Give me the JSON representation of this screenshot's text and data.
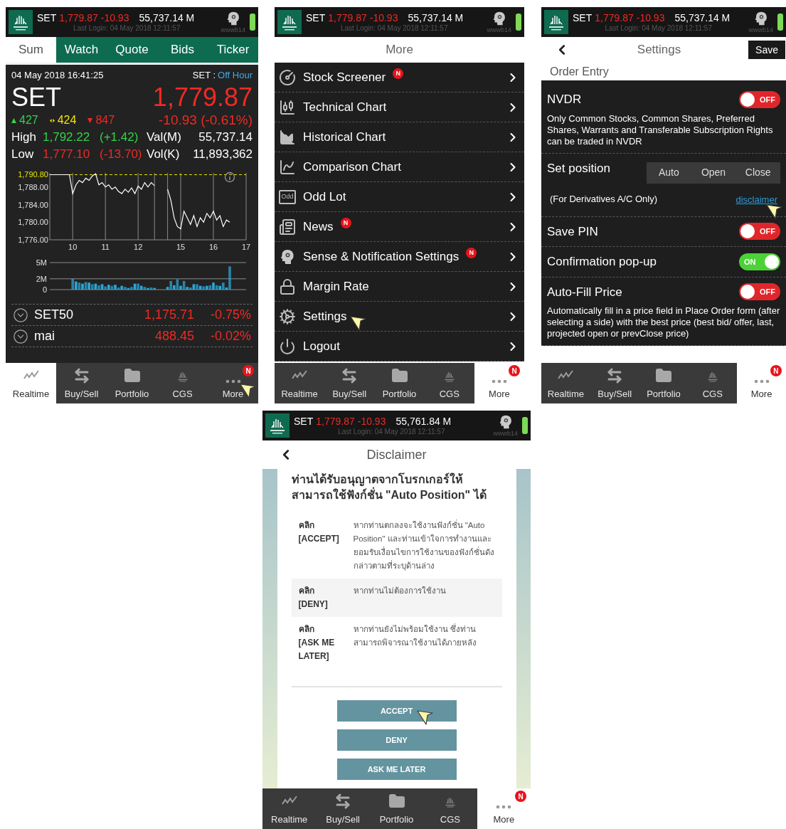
{
  "screens": [
    {
      "kind": "summary",
      "status": {
        "index": "SET",
        "price": "1,779.87",
        "change": "-10.93",
        "value": "55,737.14 M",
        "last_login": "Last Login: 04 May 2018 12:11:57",
        "user": "wwwb14"
      },
      "tabs": [
        {
          "label": "Sum",
          "selected": true
        },
        {
          "label": "Watch",
          "selected": false
        },
        {
          "label": "Quote",
          "selected": false
        },
        {
          "label": "Bids",
          "selected": false
        },
        {
          "label": "Ticker",
          "selected": false
        }
      ],
      "timestamp": "04 May 2018 16:41:25",
      "market_label": "SET :",
      "market_status": "Off Hour",
      "index_name": "SET",
      "index_price": "1,779.87",
      "breadth": [
        {
          "kind": "up",
          "count": "427"
        },
        {
          "kind": "flat",
          "count": "424"
        },
        {
          "kind": "down",
          "count": "847"
        }
      ],
      "index_change": "-10.93 (-0.61%)",
      "stats": [
        {
          "label": "High",
          "value": "1,792.22",
          "change": "(+1.42)",
          "color": "#35d24a",
          "metric": "Val(M)",
          "metric_value": "55,737.14"
        },
        {
          "label": "Low",
          "value": "1,777.10",
          "change": "(-13.70)",
          "color": "#ee2a24",
          "metric": "Vol(K)",
          "metric_value": "11,893,362"
        }
      ],
      "price_chart": {
        "chart_data": {
          "type": "line",
          "grid": true,
          "ylim": [
            1776,
            1791.2
          ],
          "categories": [
            null,
            null,
            null,
            null,
            null,
            null,
            null,
            "10",
            null,
            null,
            null,
            null,
            null,
            null,
            null,
            null,
            null,
            "11",
            null,
            null,
            null,
            null,
            null,
            null,
            null,
            null,
            null,
            "12",
            null,
            null,
            null,
            null,
            null,
            null,
            null,
            null,
            null,
            null,
            null,
            null,
            "15",
            null,
            null,
            null,
            null,
            null,
            null,
            null,
            null,
            null,
            "16",
            null,
            null,
            null,
            null,
            null,
            null,
            null,
            null,
            null,
            "17"
          ],
          "yticks": [
            {
              "value": 1776,
              "label": "1,776.00"
            },
            {
              "value": 1780,
              "label": "1,780.00"
            },
            {
              "value": 1784,
              "label": "1,784.00"
            },
            {
              "value": 1788,
              "label": "1,788.00"
            }
          ],
          "series": [
            {
              "color": "#ffffff",
              "values": [
                1790.8,
                1790.8,
                1790.8,
                1790.8,
                1790.8,
                1790.8,
                1790.8,
                1786.5,
                1788.5,
                1789.5,
                1789,
                1790,
                1789.5,
                1790.5,
                1791,
                1788.5,
                1789,
                1788,
                1788.5,
                1787.5,
                1788,
                1787,
                1786.5,
                1787.5,
                1786.8,
                1787.8,
                1786.5,
                1788.2,
                1787.5,
                1789,
                1788,
                1789,
                1788.3,
                null,
                null,
                null,
                1787.5,
                1785,
                1781,
                1779,
                1778.5,
                1782.5,
                1781,
                1779.5,
                1781.5,
                1779,
                1781,
                1780,
                1782,
                1781,
                1782.5,
                1780.5,
                1781.5,
                1779,
                1780.5,
                1780,
                null,
                null,
                null,
                null,
                null
              ]
            }
          ],
          "annotations": [
            "1,790.80"
          ]
        }
      },
      "volume_chart": {
        "chart_data": {
          "type": "bar",
          "grid": true,
          "ylim": [
            0,
            5
          ],
          "categories": [
            null,
            null,
            null,
            null,
            null,
            null,
            null,
            null,
            null,
            null,
            null,
            null,
            null,
            null,
            null,
            null,
            null,
            null,
            null,
            null,
            null,
            null,
            null,
            null,
            null,
            null,
            null,
            null,
            null,
            null,
            null,
            null,
            null,
            null,
            null,
            null,
            null,
            null,
            null,
            null,
            null,
            null,
            null,
            null,
            null,
            null,
            null,
            null,
            null,
            null,
            null,
            null,
            null,
            null,
            null,
            null,
            null,
            null,
            null,
            null,
            null
          ],
          "yticks": [
            {
              "value": 0,
              "label": "0"
            },
            {
              "value": 2,
              "label": "2M"
            },
            {
              "value": 5,
              "label": "5M"
            }
          ],
          "series": [
            {
              "color": "#2aa7d8",
              "values": [
                null,
                null,
                null,
                null,
                null,
                null,
                null,
                2.0,
                1.5,
                1.3,
                1.1,
                1.4,
                1.3,
                1.0,
                1.1,
                0.8,
                1.0,
                0.6,
                0.9,
                0.7,
                0.9,
                0.4,
                0.7,
                0.5,
                0.3,
                0.5,
                1.1,
                1.1,
                0.7,
                0.5,
                0.3,
                0.4,
                0.3,
                null,
                null,
                null,
                0.5,
                1.6,
                0.8,
                1.9,
                0.7,
                1.6,
                0.5,
                0.4,
                1.0,
                1.0,
                0.7,
                0.6,
                0.7,
                0.8,
                1.3,
                0.8,
                0.7,
                1.3,
                0.4,
                4.3,
                null,
                null,
                null,
                null,
                null
              ]
            }
          ]
        }
      },
      "indices": [
        {
          "name": "SET50",
          "price": "1,175.71",
          "change": "-0.75%"
        },
        {
          "name": "mai",
          "price": "488.45",
          "change": "-0.02%"
        }
      ],
      "nav": [
        {
          "kind": "realtime",
          "label": "Realtime",
          "selected": true
        },
        {
          "kind": "trade",
          "label": "Buy/Sell",
          "selected": false
        },
        {
          "kind": "portfolio",
          "label": "Portfolio",
          "selected": false
        },
        {
          "kind": "cgs",
          "label": "CGS",
          "selected": false
        },
        {
          "kind": "more",
          "label": "More",
          "selected": false,
          "badge": "N",
          "pointer": true
        }
      ]
    },
    {
      "kind": "menu",
      "status": {
        "index": "SET",
        "price": "1,779.87",
        "change": "-10.93",
        "value": "55,737.14 M",
        "last_login": "Last Login: 04 May 2018 12:11:57",
        "user": "wwwb14"
      },
      "title": "More",
      "items": [
        {
          "kind": "screener",
          "label": "Stock Screener",
          "badge": "N"
        },
        {
          "kind": "technical",
          "label": "Technical Chart"
        },
        {
          "kind": "historical",
          "label": "Historical Chart"
        },
        {
          "kind": "comparison",
          "label": "Comparison Chart"
        },
        {
          "kind": "oddlot",
          "label": "Odd Lot",
          "icon_text": "Odd"
        },
        {
          "kind": "news",
          "label": "News",
          "badge": "N"
        },
        {
          "kind": "sense",
          "label": "Sense & Notification Settings",
          "badge": "N"
        },
        {
          "kind": "margin",
          "label": "Margin Rate"
        },
        {
          "kind": "settings",
          "label": "Settings",
          "pointer": true
        },
        {
          "kind": "logout",
          "label": "Logout"
        }
      ],
      "nav": [
        {
          "kind": "realtime",
          "label": "Realtime",
          "selected": false
        },
        {
          "kind": "trade",
          "label": "Buy/Sell",
          "selected": false
        },
        {
          "kind": "portfolio",
          "label": "Portfolio",
          "selected": false
        },
        {
          "kind": "cgs",
          "label": "CGS",
          "selected": false
        },
        {
          "kind": "more",
          "label": "More",
          "selected": true,
          "badge": "N"
        }
      ]
    },
    {
      "kind": "settings",
      "status": {
        "index": "SET",
        "price": "1,779.87",
        "change": "-10.93",
        "value": "55,737.14 M",
        "last_login": "Last Login: 04 May 2018 12:11:57",
        "user": "wwwb14"
      },
      "title": "Settings",
      "save": "Save",
      "section": "Order Entry",
      "rows": [
        {
          "kind": "toggle",
          "label": "NVDR",
          "on": false,
          "state_label": "OFF",
          "description": "Only Common Stocks, Common Shares, Preferred Shares, Warrants and Transferable Subscription Rights can be traded in NVDR"
        },
        {
          "kind": "segments",
          "label": "Set position",
          "options": [
            {
              "label": "Auto",
              "selected": false
            },
            {
              "label": "Open",
              "selected": false
            },
            {
              "label": "Close",
              "selected": false
            }
          ],
          "note": "(For Derivatives A/C Only)",
          "link": "disclaimer",
          "pointer": true
        },
        {
          "kind": "toggle",
          "label": "Save PIN",
          "on": false,
          "state_label": "OFF"
        },
        {
          "kind": "toggle",
          "label": "Confirmation pop-up",
          "on": true,
          "state_label": "ON"
        },
        {
          "kind": "toggle",
          "label": "Auto-Fill Price",
          "on": false,
          "state_label": "OFF",
          "description": "Automatically fill in a price field in Place Order form (after selecting a side) with the best price (best bid/ offer, last, projected open or prevClose price)"
        }
      ],
      "nav": [
        {
          "kind": "realtime",
          "label": "Realtime",
          "selected": false
        },
        {
          "kind": "trade",
          "label": "Buy/Sell",
          "selected": false
        },
        {
          "kind": "portfolio",
          "label": "Portfolio",
          "selected": false
        },
        {
          "kind": "cgs",
          "label": "CGS",
          "selected": false
        },
        {
          "kind": "more",
          "label": "More",
          "selected": true,
          "badge": "N"
        }
      ]
    },
    {
      "kind": "disclaimer",
      "status": {
        "index": "SET",
        "price": "1,779.87",
        "change": "-10.93",
        "value": "55,761.84 M",
        "last_login": "Last Login: 04 May 2018 12:11:57",
        "user": "wwwb14"
      },
      "title": "Disclaimer",
      "heading": "ท่านได้รับอนุญาตจากโบรกเกอร์ให้สามารถใช้ฟังก์ชั่น \"Auto Position\" ได้",
      "options": [
        {
          "click": "คลิก",
          "option": "[ACCEPT]",
          "text": "หากท่านตกลงจะใช้งานฟังก์ชั่น \"Auto Position\" และท่านเข้าใจการทำงานและยอมรับเงื่อนไขการใช้งานของฟังก์ชั่นดังกล่าวตามที่ระบุด้านล่าง"
        },
        {
          "click": "คลิก",
          "option": "[DENY]",
          "text": "หากท่านไม่ต้องการใช้งาน"
        },
        {
          "click": "คลิก",
          "option": "[ASK ME LATER]",
          "text": "หากท่านยังไม่พร้อมใช้งาน ซึ่งท่านสามารถพิจารณาใช้งานได้ภายหลัง"
        }
      ],
      "buttons": [
        {
          "label": "ACCEPT",
          "pointer": true
        },
        {
          "label": "DENY"
        },
        {
          "label": "ASK ME LATER"
        }
      ],
      "nav": [
        {
          "kind": "realtime",
          "label": "Realtime",
          "selected": false
        },
        {
          "kind": "trade",
          "label": "Buy/Sell",
          "selected": false
        },
        {
          "kind": "portfolio",
          "label": "Portfolio",
          "selected": false
        },
        {
          "kind": "cgs",
          "label": "CGS",
          "selected": false
        },
        {
          "kind": "more",
          "label": "More",
          "selected": true,
          "badge": "N"
        }
      ]
    }
  ]
}
